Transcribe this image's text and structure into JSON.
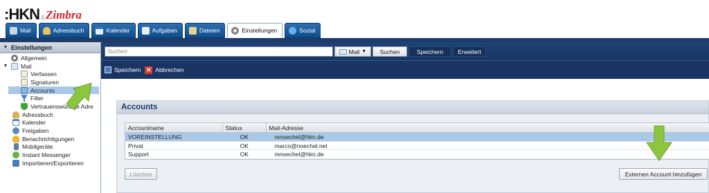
{
  "brand": {
    "logo_main": ":HKN",
    "logo_amp": "&",
    "logo_product": "Zimbra"
  },
  "app_tabs": [
    {
      "label": "Mail",
      "icon": "mail-icon",
      "color": "#c9d7e6"
    },
    {
      "label": "Adressbuch",
      "icon": "addressbook-icon",
      "color": "#f0c060"
    },
    {
      "label": "Kalender",
      "icon": "calendar-icon",
      "color": "#e8eef6"
    },
    {
      "label": "Aufgaben",
      "icon": "tasks-icon",
      "color": "#e8eef6"
    },
    {
      "label": "Dateien",
      "icon": "files-icon",
      "color": "#e8d38a"
    },
    {
      "label": "Einstellungen",
      "icon": "gear-icon",
      "color": "#bbbbbb"
    },
    {
      "label": "Sozial",
      "icon": "social-icon",
      "color": "#6ab0e8"
    }
  ],
  "sidebar": {
    "header": "Einstellungen",
    "items": [
      {
        "label": "Allgemein",
        "level": 0,
        "icon": "gear-icon",
        "color": "#777777"
      },
      {
        "label": "Mail",
        "level": 0,
        "icon": "mail-icon",
        "color": "#a9c3de",
        "expanded": true
      },
      {
        "label": "Verfassen",
        "level": 1,
        "icon": "compose-icon",
        "color": "#e9e4c8"
      },
      {
        "label": "Signaturen",
        "level": 1,
        "icon": "signature-icon",
        "color": "#e9e4c8"
      },
      {
        "label": "Accounts",
        "level": 1,
        "icon": "accounts-icon",
        "color": "#8fb4dc",
        "selected": true
      },
      {
        "label": "Filter",
        "level": 1,
        "icon": "filter-icon",
        "color": "#3a7fd0"
      },
      {
        "label": "Vertrauenswürdige Adre",
        "level": 1,
        "icon": "shield-icon",
        "color": "#3da33d"
      },
      {
        "label": "Adressbuch",
        "level": 0,
        "icon": "addressbook-icon",
        "color": "#e0b050"
      },
      {
        "label": "Kalender",
        "level": 0,
        "icon": "calendar-icon",
        "color": "#4a84c6"
      },
      {
        "label": "Freigaben",
        "level": 0,
        "icon": "sharing-icon",
        "color": "#5b88c0"
      },
      {
        "label": "Benachrichtigungen",
        "level": 0,
        "icon": "notification-icon",
        "color": "#f0b530"
      },
      {
        "label": "Mobilgeräte",
        "level": 0,
        "icon": "mobile-icon",
        "color": "#5a7fa8"
      },
      {
        "label": "Instant Messenger",
        "level": 0,
        "icon": "messenger-icon",
        "color": "#64b33c"
      },
      {
        "label": "Importieren/Exportieren",
        "level": 0,
        "icon": "import-export-icon",
        "color": "#4a7cb8"
      }
    ]
  },
  "search": {
    "placeholder": "Suchen",
    "scope_label": "Mail",
    "search_button": "Suchen",
    "save_button": "Speichern",
    "advanced_button": "Erweitert"
  },
  "toolbar": {
    "save_label": "Speichern",
    "cancel_label": "Abbrechen"
  },
  "accounts": {
    "title": "Accounts",
    "columns": [
      "Accountname",
      "Status",
      "Mail-Adresse"
    ],
    "rows": [
      {
        "name": "VOREINSTELLUNG",
        "status": "OK",
        "email": "mnoechel@hkn.de",
        "selected": true
      },
      {
        "name": "Privat",
        "status": "OK",
        "email": "marco@noechel.net"
      },
      {
        "name": "Support",
        "status": "OK",
        "email": "mnoechel@hkn.de"
      }
    ],
    "delete_button": "Löschen",
    "add_external_button": "Externen Account hinzufügen"
  },
  "colors": {
    "accent_green": "#8cc63f",
    "nav_dark": "#1a3563",
    "selection": "#aac8e8"
  }
}
